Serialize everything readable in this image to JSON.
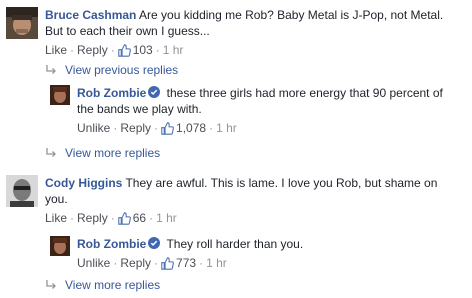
{
  "comments": [
    {
      "author": "Bruce Cashman",
      "text": "Are you kidding me Rob? Baby Metal is J-Pop, not Metal. But to each their own I guess...",
      "action_like": "Like",
      "action_reply": "Reply",
      "likes": "103",
      "time": "1 hr"
    },
    {
      "author": "Cody Higgins",
      "text": "They are awful. This is lame. I love you Rob, but shame on you.",
      "action_like": "Like",
      "action_reply": "Reply",
      "likes": "66",
      "time": "1 hr"
    }
  ],
  "replies": [
    {
      "author": "Rob Zombie",
      "text": "these three girls had more energy that 90 percent of the bands we play with.",
      "action_like": "Unlike",
      "action_reply": "Reply",
      "likes": "1,078",
      "time": "1 hr"
    },
    {
      "author": "Rob Zombie",
      "text": "They roll harder than you.",
      "action_like": "Unlike",
      "action_reply": "Reply",
      "likes": "773",
      "time": "1 hr"
    }
  ],
  "links": {
    "view_previous_replies": "View previous replies",
    "view_more_replies_1": "View more replies",
    "view_more_replies_2": "View more replies"
  },
  "colors": {
    "author": "#365899",
    "meta": "#90949c",
    "verified": "#4267b2"
  },
  "icons": {
    "like": "thumbs-up-icon",
    "verified": "verified-badge-icon",
    "reply_arrow": "reply-arrow-icon"
  }
}
